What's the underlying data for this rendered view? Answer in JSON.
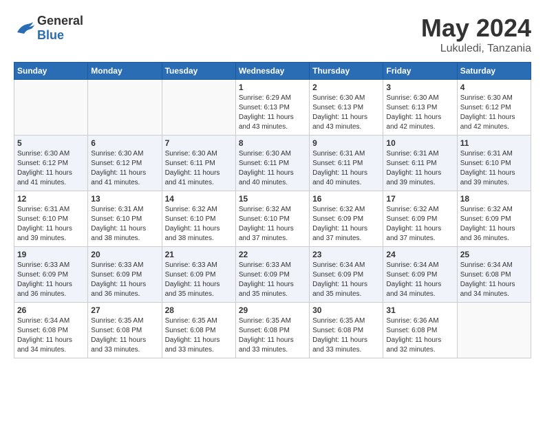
{
  "logo": {
    "general": "General",
    "blue": "Blue"
  },
  "header": {
    "month": "May 2024",
    "location": "Lukuledi, Tanzania"
  },
  "weekdays": [
    "Sunday",
    "Monday",
    "Tuesday",
    "Wednesday",
    "Thursday",
    "Friday",
    "Saturday"
  ],
  "weeks": [
    [
      {
        "day": "",
        "info": ""
      },
      {
        "day": "",
        "info": ""
      },
      {
        "day": "",
        "info": ""
      },
      {
        "day": "1",
        "info": "Sunrise: 6:29 AM\nSunset: 6:13 PM\nDaylight: 11 hours\nand 43 minutes."
      },
      {
        "day": "2",
        "info": "Sunrise: 6:30 AM\nSunset: 6:13 PM\nDaylight: 11 hours\nand 43 minutes."
      },
      {
        "day": "3",
        "info": "Sunrise: 6:30 AM\nSunset: 6:13 PM\nDaylight: 11 hours\nand 42 minutes."
      },
      {
        "day": "4",
        "info": "Sunrise: 6:30 AM\nSunset: 6:12 PM\nDaylight: 11 hours\nand 42 minutes."
      }
    ],
    [
      {
        "day": "5",
        "info": "Sunrise: 6:30 AM\nSunset: 6:12 PM\nDaylight: 11 hours\nand 41 minutes."
      },
      {
        "day": "6",
        "info": "Sunrise: 6:30 AM\nSunset: 6:12 PM\nDaylight: 11 hours\nand 41 minutes."
      },
      {
        "day": "7",
        "info": "Sunrise: 6:30 AM\nSunset: 6:11 PM\nDaylight: 11 hours\nand 41 minutes."
      },
      {
        "day": "8",
        "info": "Sunrise: 6:30 AM\nSunset: 6:11 PM\nDaylight: 11 hours\nand 40 minutes."
      },
      {
        "day": "9",
        "info": "Sunrise: 6:31 AM\nSunset: 6:11 PM\nDaylight: 11 hours\nand 40 minutes."
      },
      {
        "day": "10",
        "info": "Sunrise: 6:31 AM\nSunset: 6:11 PM\nDaylight: 11 hours\nand 39 minutes."
      },
      {
        "day": "11",
        "info": "Sunrise: 6:31 AM\nSunset: 6:10 PM\nDaylight: 11 hours\nand 39 minutes."
      }
    ],
    [
      {
        "day": "12",
        "info": "Sunrise: 6:31 AM\nSunset: 6:10 PM\nDaylight: 11 hours\nand 39 minutes."
      },
      {
        "day": "13",
        "info": "Sunrise: 6:31 AM\nSunset: 6:10 PM\nDaylight: 11 hours\nand 38 minutes."
      },
      {
        "day": "14",
        "info": "Sunrise: 6:32 AM\nSunset: 6:10 PM\nDaylight: 11 hours\nand 38 minutes."
      },
      {
        "day": "15",
        "info": "Sunrise: 6:32 AM\nSunset: 6:10 PM\nDaylight: 11 hours\nand 37 minutes."
      },
      {
        "day": "16",
        "info": "Sunrise: 6:32 AM\nSunset: 6:09 PM\nDaylight: 11 hours\nand 37 minutes."
      },
      {
        "day": "17",
        "info": "Sunrise: 6:32 AM\nSunset: 6:09 PM\nDaylight: 11 hours\nand 37 minutes."
      },
      {
        "day": "18",
        "info": "Sunrise: 6:32 AM\nSunset: 6:09 PM\nDaylight: 11 hours\nand 36 minutes."
      }
    ],
    [
      {
        "day": "19",
        "info": "Sunrise: 6:33 AM\nSunset: 6:09 PM\nDaylight: 11 hours\nand 36 minutes."
      },
      {
        "day": "20",
        "info": "Sunrise: 6:33 AM\nSunset: 6:09 PM\nDaylight: 11 hours\nand 36 minutes."
      },
      {
        "day": "21",
        "info": "Sunrise: 6:33 AM\nSunset: 6:09 PM\nDaylight: 11 hours\nand 35 minutes."
      },
      {
        "day": "22",
        "info": "Sunrise: 6:33 AM\nSunset: 6:09 PM\nDaylight: 11 hours\nand 35 minutes."
      },
      {
        "day": "23",
        "info": "Sunrise: 6:34 AM\nSunset: 6:09 PM\nDaylight: 11 hours\nand 35 minutes."
      },
      {
        "day": "24",
        "info": "Sunrise: 6:34 AM\nSunset: 6:09 PM\nDaylight: 11 hours\nand 34 minutes."
      },
      {
        "day": "25",
        "info": "Sunrise: 6:34 AM\nSunset: 6:08 PM\nDaylight: 11 hours\nand 34 minutes."
      }
    ],
    [
      {
        "day": "26",
        "info": "Sunrise: 6:34 AM\nSunset: 6:08 PM\nDaylight: 11 hours\nand 34 minutes."
      },
      {
        "day": "27",
        "info": "Sunrise: 6:35 AM\nSunset: 6:08 PM\nDaylight: 11 hours\nand 33 minutes."
      },
      {
        "day": "28",
        "info": "Sunrise: 6:35 AM\nSunset: 6:08 PM\nDaylight: 11 hours\nand 33 minutes."
      },
      {
        "day": "29",
        "info": "Sunrise: 6:35 AM\nSunset: 6:08 PM\nDaylight: 11 hours\nand 33 minutes."
      },
      {
        "day": "30",
        "info": "Sunrise: 6:35 AM\nSunset: 6:08 PM\nDaylight: 11 hours\nand 33 minutes."
      },
      {
        "day": "31",
        "info": "Sunrise: 6:36 AM\nSunset: 6:08 PM\nDaylight: 11 hours\nand 32 minutes."
      },
      {
        "day": "",
        "info": ""
      }
    ]
  ]
}
